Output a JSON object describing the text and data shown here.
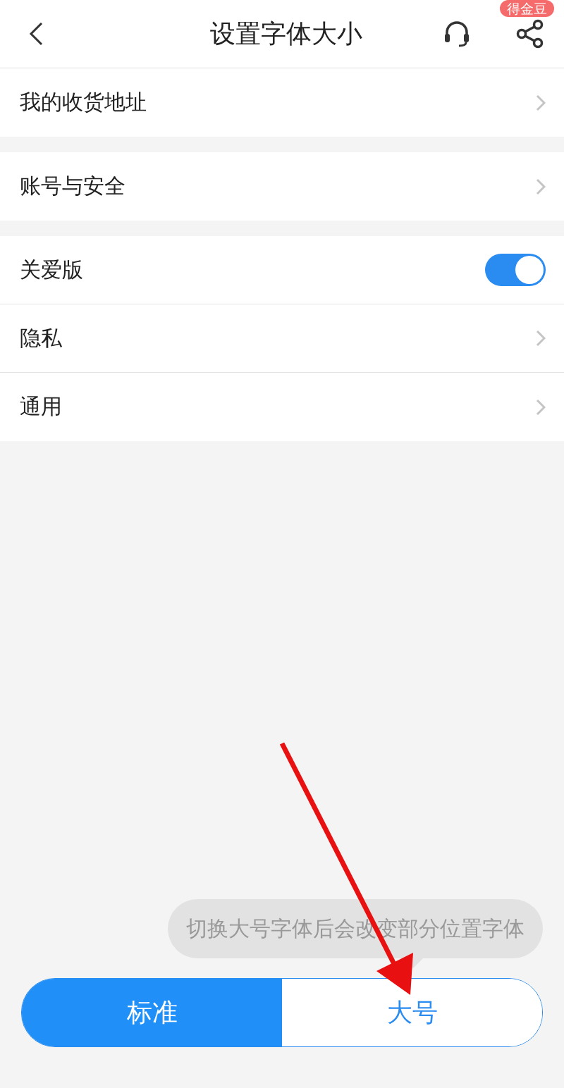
{
  "header": {
    "title": "设置字体大小",
    "badge": "得金豆"
  },
  "sections": [
    {
      "items": [
        {
          "label": "我的收货地址",
          "kind": "link"
        }
      ]
    },
    {
      "items": [
        {
          "label": "账号与安全",
          "kind": "link"
        }
      ]
    },
    {
      "items": [
        {
          "label": "关爱版",
          "kind": "toggle",
          "on": true
        },
        {
          "label": "隐私",
          "kind": "link"
        },
        {
          "label": "通用",
          "kind": "link"
        }
      ]
    }
  ],
  "hint": "切换大号字体后会改变部分位置字体",
  "font_size_options": [
    {
      "label": "标准",
      "selected": true
    },
    {
      "label": "大号",
      "selected": false
    }
  ]
}
